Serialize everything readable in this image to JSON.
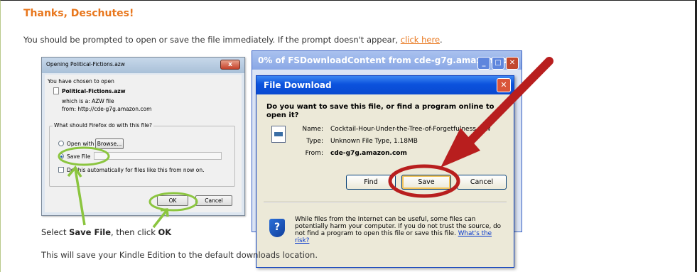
{
  "page": {
    "heading": "Thanks, Deschutes!",
    "prompt_text": "You should be prompted to open or save the file immediately. If the prompt doesn't appear, ",
    "prompt_link": "click here",
    "prompt_end": ".",
    "select_prefix": "Select ",
    "select_bold1": "Save File",
    "select_mid": ", then click ",
    "select_bold2": "OK",
    "save_text": "This will save your Kindle Edition to the default downloads location."
  },
  "firefox_dialog": {
    "title": "Opening Political-Fictions.azw",
    "close": "x",
    "chosen": "You have chosen to open",
    "filename": "Political-Fictions.azw",
    "which_is": "which is a:  AZW file",
    "from": "from:  http://cde-g7g.amazon.com",
    "question": "What should Firefox do with this file?",
    "open_with": "Open with",
    "browse": "Browse...",
    "save_file": "Save File",
    "auto": "Do this automatically for files like this from now on.",
    "ok": "OK",
    "cancel": "Cancel"
  },
  "xp_back": {
    "title": "0% of FSDownloadContent from cde-g7g.amazon.co..."
  },
  "xp_dialog": {
    "title": "File Download",
    "question": "Do you want to save this file, or find a program online to open it?",
    "name_label": "Name:",
    "name_value": "Cocktail-Hour-Under-the-Tree-of-Forgetfulness.azw",
    "type_label": "Type:",
    "type_value": "Unknown File Type, 1.18MB",
    "from_label": "From:",
    "from_value": "cde-g7g.amazon.com",
    "find": "Find",
    "save": "Save",
    "cancel": "Cancel",
    "warning": "While files from the Internet can be useful, some files can potentially harm your computer. If you do not trust the source, do not find a program to open this file or save this file. ",
    "risk_link": "What's the risk?"
  },
  "colors": {
    "heading": "#e8761c",
    "red_arrow": "#b81e1e",
    "green_highlight": "#8bc53f"
  }
}
